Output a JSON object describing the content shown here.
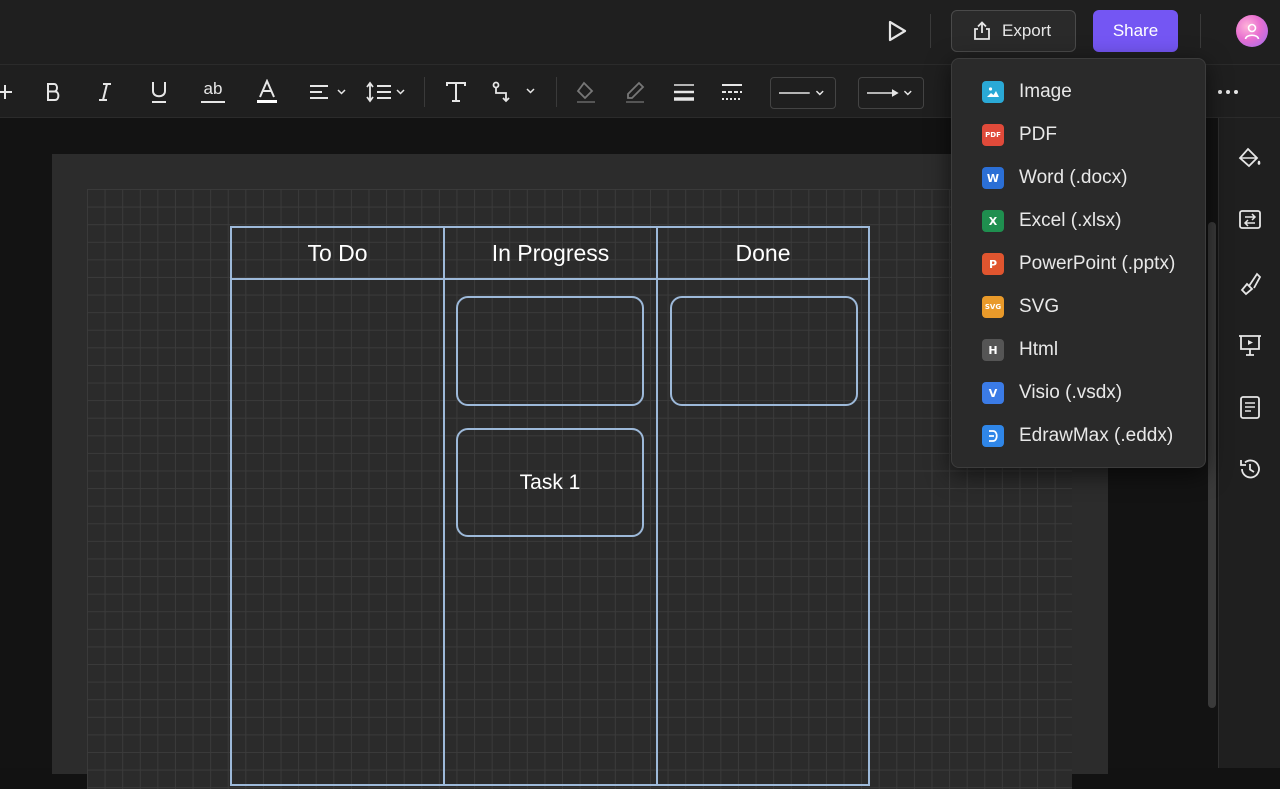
{
  "header": {
    "export_label": "Export",
    "share_label": "Share"
  },
  "toolbar": {
    "text_underline_label": "ab"
  },
  "board": {
    "columns": [
      "To Do",
      "In Progress",
      "Done"
    ],
    "cards": [
      {
        "column": "In Progress",
        "text": ""
      },
      {
        "column": "Done",
        "text": ""
      },
      {
        "column": "In Progress",
        "text": "Task 1"
      }
    ]
  },
  "export_menu": {
    "items": [
      {
        "label": "Image",
        "icon": "image-icon",
        "icon_text": "",
        "color": "#2aa9d6"
      },
      {
        "label": "PDF",
        "icon": "pdf-icon",
        "icon_text": "PDF",
        "color": "#e04a3a"
      },
      {
        "label": "Word (.docx)",
        "icon": "word-icon",
        "icon_text": "W",
        "color": "#2b6fd6"
      },
      {
        "label": "Excel (.xlsx)",
        "icon": "excel-icon",
        "icon_text": "X",
        "color": "#1f8f4f"
      },
      {
        "label": "PowerPoint (.pptx)",
        "icon": "powerpoint-icon",
        "icon_text": "P",
        "color": "#e0552f"
      },
      {
        "label": "SVG",
        "icon": "svg-icon",
        "icon_text": "SVG",
        "color": "#e99a2a"
      },
      {
        "label": "Html",
        "icon": "html-icon",
        "icon_text": "H",
        "color": "#555555"
      },
      {
        "label": "Visio (.vsdx)",
        "icon": "visio-icon",
        "icon_text": "V",
        "color": "#3b7be6"
      },
      {
        "label": "EdrawMax (.eddx)",
        "icon": "edrawmax-icon",
        "icon_text": "D",
        "color": "#2f86e8"
      }
    ]
  },
  "colors": {
    "accent": "#7456f3",
    "board_line": "#9db9d9",
    "background": "#1f1f1f"
  }
}
